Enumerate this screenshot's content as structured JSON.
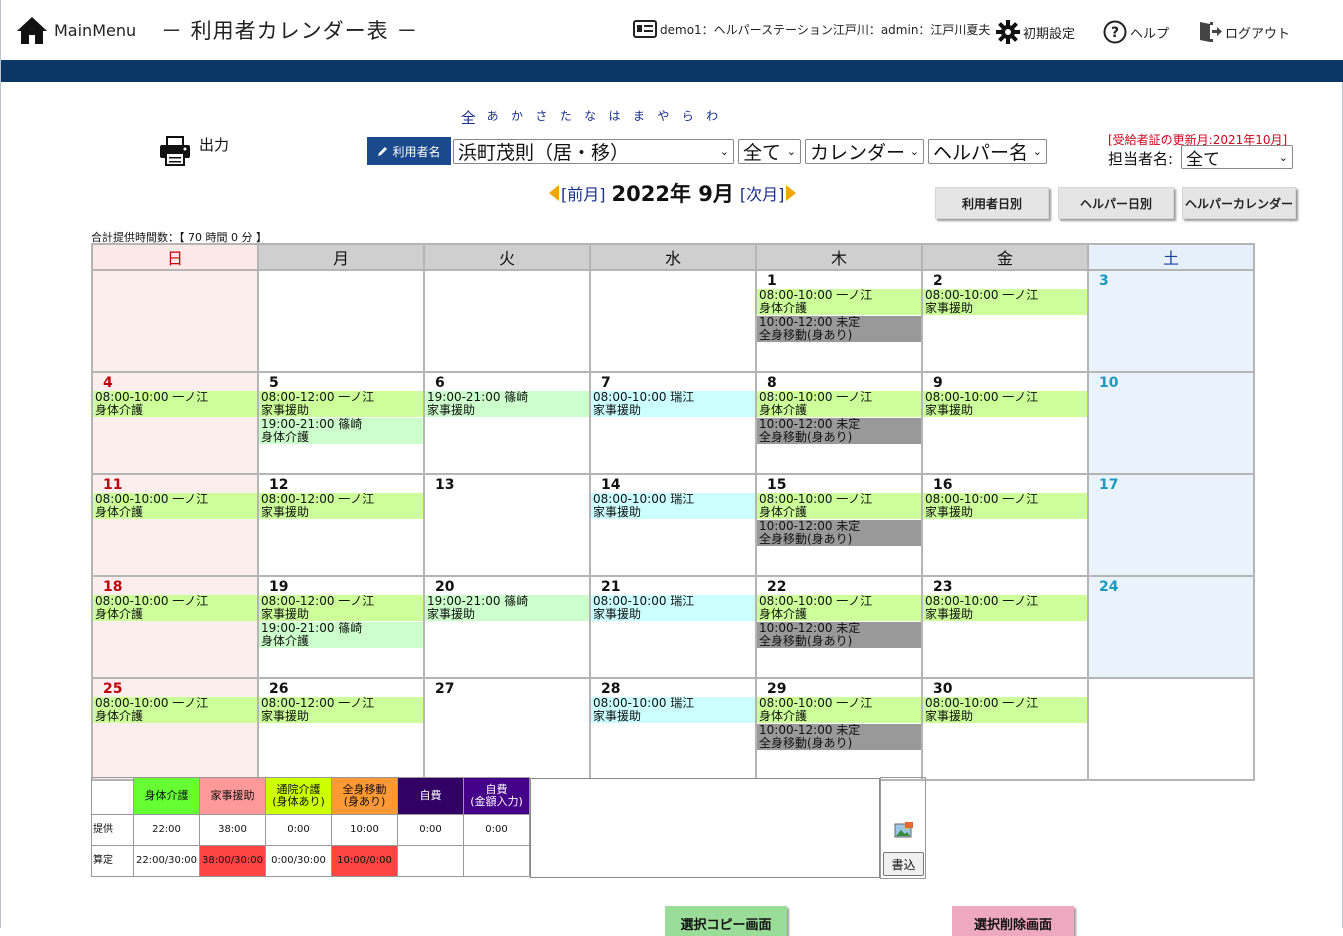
{
  "header": {
    "main_menu": "MainMenu",
    "title": "－ 利用者カレンダー表 －",
    "account": "demo1：ヘルパーステーション江戸川：admin：江戸川夏夫",
    "settings": "初期設定",
    "help": "ヘルプ",
    "logout": "ログアウト"
  },
  "kana": [
    "全",
    "あ",
    "か",
    "さ",
    "た",
    "な",
    "は",
    "ま",
    "や",
    "ら",
    "わ"
  ],
  "print_label": "出力",
  "user_label": "利用者名",
  "selects": {
    "user": "浜町茂則（居・移）",
    "filter": "全て",
    "view": "カレンダー",
    "sort": "ヘルパー名",
    "tanto": "全て"
  },
  "renewal_notice": "[受給者証の更新月:2021年10月]",
  "tanto_label": "担当者名:",
  "month_nav": {
    "prev": "[前月]",
    "year_month": "2022年 9月",
    "next": "[次月]"
  },
  "buttons": {
    "user_daily": "利用者日別",
    "helper_daily": "ヘルパー日別",
    "helper_calendar": "ヘルパーカレンダー"
  },
  "total_hours": "合計提供時間数：【 70 時間 0 分 】",
  "weekdays": [
    "日",
    "月",
    "火",
    "水",
    "木",
    "金",
    "土"
  ],
  "weeks": [
    [
      {
        "day": "",
        "events": []
      },
      {
        "day": "",
        "events": []
      },
      {
        "day": "",
        "events": []
      },
      {
        "day": "",
        "events": []
      },
      {
        "day": "1",
        "events": [
          {
            "line1": "08:00-10:00 一ノ江",
            "line2": "身体介護",
            "color": "green"
          },
          {
            "line1": "10:00-12:00 未定",
            "line2": "全身移動(身あり)",
            "color": "gray"
          }
        ]
      },
      {
        "day": "2",
        "events": [
          {
            "line1": "08:00-10:00 一ノ江",
            "line2": "家事援助",
            "color": "green"
          }
        ]
      },
      {
        "day": "3",
        "events": []
      }
    ],
    [
      {
        "day": "4",
        "events": [
          {
            "line1": "08:00-10:00 一ノ江",
            "line2": "身体介護",
            "color": "green"
          }
        ]
      },
      {
        "day": "5",
        "events": [
          {
            "line1": "08:00-12:00 一ノ江",
            "line2": "家事援助",
            "color": "green"
          },
          {
            "line1": "19:00-21:00 篠崎",
            "line2": "身体介護",
            "color": "lgreen"
          }
        ]
      },
      {
        "day": "6",
        "events": [
          {
            "line1": "19:00-21:00 篠崎",
            "line2": "家事援助",
            "color": "lgreen"
          }
        ]
      },
      {
        "day": "7",
        "events": [
          {
            "line1": "08:00-10:00 瑞江",
            "line2": "家事援助",
            "color": "cyan"
          }
        ]
      },
      {
        "day": "8",
        "events": [
          {
            "line1": "08:00-10:00 一ノ江",
            "line2": "身体介護",
            "color": "green"
          },
          {
            "line1": "10:00-12:00 未定",
            "line2": "全身移動(身あり)",
            "color": "gray"
          }
        ]
      },
      {
        "day": "9",
        "events": [
          {
            "line1": "08:00-10:00 一ノ江",
            "line2": "家事援助",
            "color": "green"
          }
        ]
      },
      {
        "day": "10",
        "events": []
      }
    ],
    [
      {
        "day": "11",
        "events": [
          {
            "line1": "08:00-10:00 一ノ江",
            "line2": "身体介護",
            "color": "green"
          }
        ]
      },
      {
        "day": "12",
        "events": [
          {
            "line1": "08:00-12:00 一ノ江",
            "line2": "家事援助",
            "color": "green"
          }
        ]
      },
      {
        "day": "13",
        "events": []
      },
      {
        "day": "14",
        "events": [
          {
            "line1": "08:00-10:00 瑞江",
            "line2": "家事援助",
            "color": "cyan"
          }
        ]
      },
      {
        "day": "15",
        "events": [
          {
            "line1": "08:00-10:00 一ノ江",
            "line2": "身体介護",
            "color": "green"
          },
          {
            "line1": "10:00-12:00 未定",
            "line2": "全身移動(身あり)",
            "color": "gray"
          }
        ]
      },
      {
        "day": "16",
        "events": [
          {
            "line1": "08:00-10:00 一ノ江",
            "line2": "家事援助",
            "color": "green"
          }
        ]
      },
      {
        "day": "17",
        "events": []
      }
    ],
    [
      {
        "day": "18",
        "events": [
          {
            "line1": "08:00-10:00 一ノ江",
            "line2": "身体介護",
            "color": "green"
          }
        ]
      },
      {
        "day": "19",
        "events": [
          {
            "line1": "08:00-12:00 一ノ江",
            "line2": "家事援助",
            "color": "green"
          },
          {
            "line1": "19:00-21:00 篠崎",
            "line2": "身体介護",
            "color": "lgreen"
          }
        ]
      },
      {
        "day": "20",
        "events": [
          {
            "line1": "19:00-21:00 篠崎",
            "line2": "家事援助",
            "color": "lgreen"
          }
        ]
      },
      {
        "day": "21",
        "events": [
          {
            "line1": "08:00-10:00 瑞江",
            "line2": "家事援助",
            "color": "cyan"
          }
        ]
      },
      {
        "day": "22",
        "events": [
          {
            "line1": "08:00-10:00 一ノ江",
            "line2": "身体介護",
            "color": "green"
          },
          {
            "line1": "10:00-12:00 未定",
            "line2": "全身移動(身あり)",
            "color": "gray"
          }
        ]
      },
      {
        "day": "23",
        "events": [
          {
            "line1": "08:00-10:00 一ノ江",
            "line2": "家事援助",
            "color": "green"
          }
        ]
      },
      {
        "day": "24",
        "events": []
      }
    ],
    [
      {
        "day": "25",
        "events": [
          {
            "line1": "08:00-10:00 一ノ江",
            "line2": "身体介護",
            "color": "green"
          }
        ]
      },
      {
        "day": "26",
        "events": [
          {
            "line1": "08:00-12:00 一ノ江",
            "line2": "家事援助",
            "color": "green"
          }
        ]
      },
      {
        "day": "27",
        "events": []
      },
      {
        "day": "28",
        "events": [
          {
            "line1": "08:00-10:00 瑞江",
            "line2": "家事援助",
            "color": "cyan"
          }
        ]
      },
      {
        "day": "29",
        "events": [
          {
            "line1": "08:00-10:00 一ノ江",
            "line2": "身体介護",
            "color": "green"
          },
          {
            "line1": "10:00-12:00 未定",
            "line2": "全身移動(身あり)",
            "color": "gray"
          }
        ]
      },
      {
        "day": "30",
        "events": [
          {
            "line1": "08:00-10:00 一ノ江",
            "line2": "家事援助",
            "color": "green"
          }
        ]
      },
      {
        "day": "",
        "events": []
      }
    ]
  ],
  "summary": {
    "row_labels": [
      "提供",
      "算定"
    ],
    "columns": [
      {
        "name": "身体介護",
        "bg": "#66ff33",
        "fg": "#111111",
        "provided": "22:00",
        "calc": "22:00/30:00",
        "calc_bg": "#ffffff"
      },
      {
        "name": "家事援助",
        "bg": "#ff9999",
        "fg": "#111111",
        "provided": "38:00",
        "calc": "38:00/30:00",
        "calc_bg": "#ff4444"
      },
      {
        "name": "通院介護\n(身体あり)",
        "bg": "#ccff00",
        "fg": "#111111",
        "provided": "0:00",
        "calc": "0:00/30:00",
        "calc_bg": "#ffffff"
      },
      {
        "name": "全身移動\n(身あり)",
        "bg": "#ff9933",
        "fg": "#111111",
        "provided": "10:00",
        "calc": "10:00/0:00",
        "calc_bg": "#ff4444"
      },
      {
        "name": "自費",
        "bg": "#330066",
        "fg": "#ffffff",
        "provided": "0:00",
        "calc": "",
        "calc_bg": "#ffffff"
      },
      {
        "name": "自費\n(金額入力)",
        "bg": "#440088",
        "fg": "#ffffff",
        "provided": "0:00",
        "calc": "",
        "calc_bg": "#ffffff"
      }
    ]
  },
  "write_label": "書込",
  "bottom_buttons": {
    "copy": "選択コピー画面",
    "delete": "選択削除画面"
  },
  "colors": {
    "navy_bar": "#0b3766",
    "event_green": "#ccff99",
    "event_lgreen": "#ccffcc",
    "event_cyan": "#ccffff",
    "event_gray": "#999999"
  }
}
